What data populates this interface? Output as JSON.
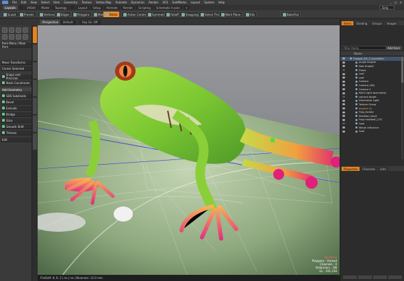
{
  "menubar": {
    "items": [
      "File",
      "Edit",
      "View",
      "Select",
      "Item",
      "Geometry",
      "Texture",
      "Vertex Map",
      "Animate",
      "Dynamics",
      "Render",
      "ACS",
      "GoldMarks",
      "Layout",
      "System",
      "Help"
    ],
    "winctrl": [
      "_",
      "□",
      "×"
    ]
  },
  "layoutbar": {
    "tabs": [
      "Layouts",
      "",
      "UVEdit",
      "Model",
      "Topology",
      "",
      "Layout",
      "Setup",
      "Animate",
      "Render",
      "Scripting",
      "Schematic Fusion",
      "+"
    ],
    "active_index": 0,
    "only_label": "Only"
  },
  "toolbar1": {
    "buttons": [
      {
        "label": "Sculpt",
        "orange": false
      },
      {
        "label": "Presets",
        "orange": false
      },
      {
        "label": "Vertices",
        "orange": false
      },
      {
        "label": "Edges",
        "orange": false
      },
      {
        "label": "Polygons",
        "orange": false
      },
      {
        "label": "Materials",
        "orange": false
      },
      {
        "label": "Items",
        "orange": true
      },
      {
        "label": "Action Center",
        "orange": false
      },
      {
        "label": "Symmetry",
        "orange": false
      },
      {
        "label": "Falloff",
        "orange": false
      },
      {
        "label": "Snapping",
        "orange": false
      },
      {
        "label": "Select Through",
        "orange": false
      },
      {
        "label": "Work Plane",
        "orange": false
      },
      {
        "label": "Kits",
        "orange": false
      },
      {
        "label": "BakeFlat",
        "orange": false
      }
    ]
  },
  "viewtabs": [
    "Perspective",
    "Default",
    "Ray GL: Off"
  ],
  "leftpanel": {
    "rows": [
      {
        "label": "Item Menu / New Item",
        "head": false
      },
      {
        "label": "Move Transforms",
        "head": false
      },
      {
        "label": "Center Selected",
        "head": false
      },
      {
        "label": "Snaps and Precision",
        "head": false
      },
      {
        "label": "Mesh Constraints",
        "head": false
      },
      {
        "label": "Add Geometry",
        "head": true
      },
      {
        "label": "SDS Subdivide",
        "head": false
      },
      {
        "label": "Bevel",
        "head": false
      },
      {
        "label": "Extrude",
        "head": false
      },
      {
        "label": "Bridge",
        "head": false
      },
      {
        "label": "Slice",
        "head": false
      },
      {
        "label": "Smooth Shift",
        "head": false
      },
      {
        "label": "Thicken",
        "head": false
      },
      {
        "label": "Edit",
        "head": false
      }
    ]
  },
  "viewport": {
    "status": "FlatSoft: 8, 8, 2 | no | no | Blueness: 12.0 mm",
    "info": [
      "No Items",
      "Polygons : Unread",
      "Channels : 0",
      "Deformers : ON",
      "GL : 191,236"
    ]
  },
  "rightpanel": {
    "tabs_top": [
      "Items",
      "Shading",
      "Groups",
      "Images"
    ],
    "filter_placeholder": "Filter Items",
    "add_button": "Add Item",
    "col_header": "Name",
    "items": [
      {
        "label": "Frogpat_RG_2_bundleScn",
        "sel": true,
        "cls": ""
      },
      {
        "label": "jungle droplet",
        "sel": false,
        "cls": ""
      },
      {
        "label": "New droplet",
        "sel": false,
        "cls": ""
      },
      {
        "label": "Drops",
        "sel": false,
        "cls": ""
      },
      {
        "label": "Leaf",
        "sel": false,
        "cls": ""
      },
      {
        "label": "Leaf",
        "sel": false,
        "cls": ""
      },
      {
        "label": "Camera",
        "sel": false,
        "cls": ""
      },
      {
        "label": "Camera (UB)",
        "sel": false,
        "cls": ""
      },
      {
        "label": "Camera 2",
        "sel": false,
        "cls": ""
      },
      {
        "label": "Point Light specularity",
        "sel": false,
        "cls": ""
      },
      {
        "label": "camera target",
        "sel": false,
        "cls": ""
      },
      {
        "label": "Directional Light",
        "sel": false,
        "cls": ""
      },
      {
        "label": "Texture Group",
        "sel": false,
        "cls": ""
      },
      {
        "label": "Implicit (1)",
        "sel": false,
        "cls": "orange"
      },
      {
        "label": "Frog_locator",
        "sel": false,
        "cls": ""
      },
      {
        "label": "Skeleton_bend",
        "sel": false,
        "cls": ""
      },
      {
        "label": "Frog+rootleaf_COC",
        "sel": false,
        "cls": ""
      },
      {
        "label": "Goal",
        "sel": false,
        "cls": ""
      },
      {
        "label": "Morph Influence",
        "sel": false,
        "cls": ""
      },
      {
        "label": "Goal",
        "sel": false,
        "cls": ""
      }
    ],
    "tabs_bottom": [
      "Properties",
      "Channels",
      "Lists"
    ]
  }
}
